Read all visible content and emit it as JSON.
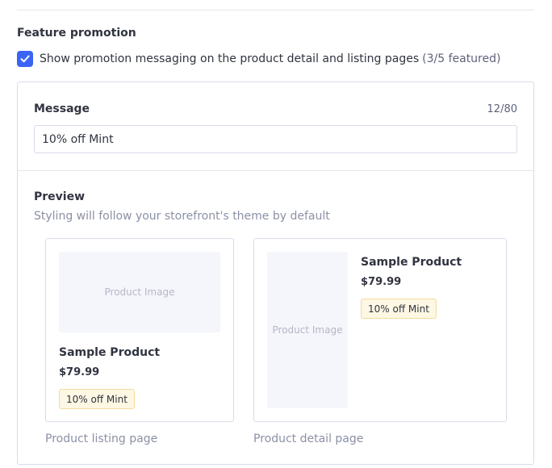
{
  "feature": {
    "title": "Feature promotion",
    "checkbox_checked": true,
    "checkbox_label": "Show promotion messaging on the product detail and listing pages",
    "featured_count": "(3/5 featured)"
  },
  "message": {
    "label": "Message",
    "counter": "12/80",
    "value": "10% off Mint"
  },
  "preview": {
    "title": "Preview",
    "description": "Styling will follow your storefront's theme by default",
    "listing": {
      "image_label": "Product Image",
      "product_name": "Sample Product",
      "price": "$79.99",
      "badge": "10% off Mint",
      "caption": "Product listing page"
    },
    "detail": {
      "image_label": "Product Image",
      "product_name": "Sample Product",
      "price": "$79.99",
      "badge": "10% off Mint",
      "caption": "Product detail page"
    }
  },
  "colors": {
    "accent": "#3c64f4",
    "badge_bg": "#fdf7e3",
    "badge_border": "#f2dc9e",
    "placeholder_bg": "#f5f6fb"
  },
  "icons": {
    "checkbox": "checkmark-icon"
  }
}
